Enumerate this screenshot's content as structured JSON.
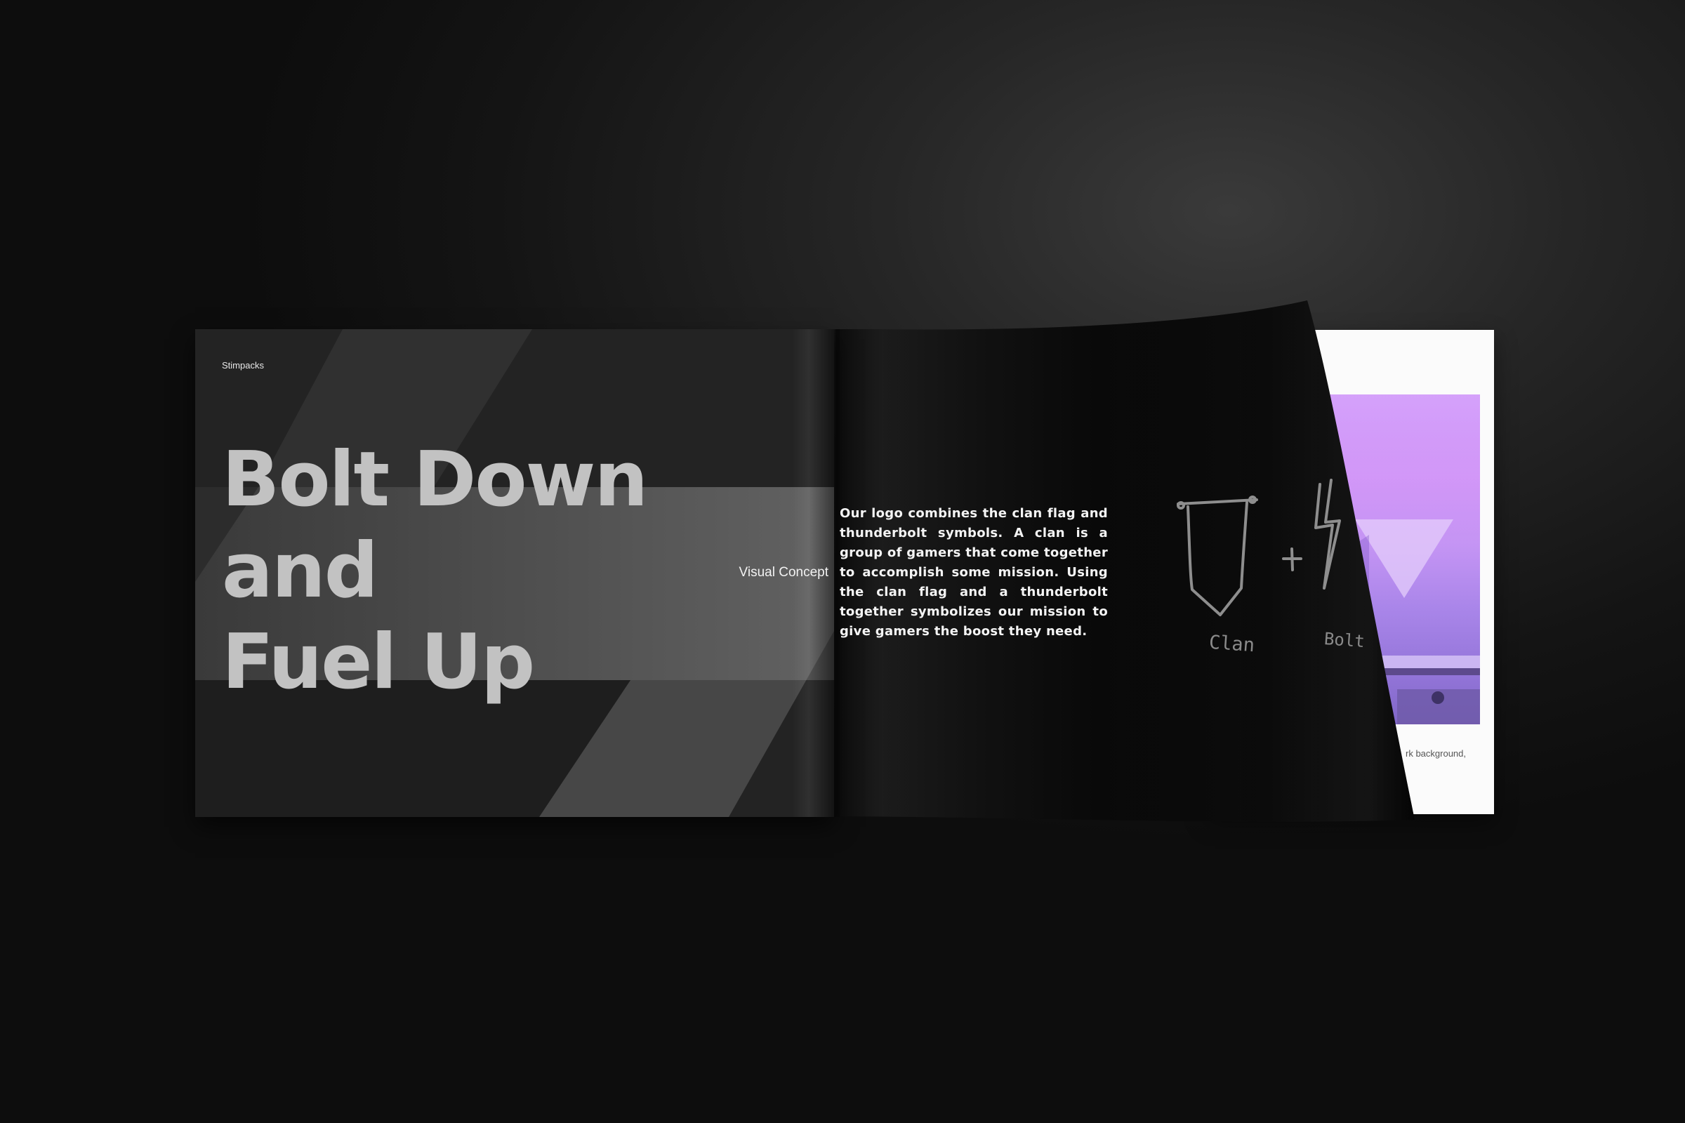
{
  "brochure": {
    "brand_label": "Stimpacks",
    "headline": "Bolt Down\nand\nFuel Up",
    "section_title": "Visual Concept",
    "body_copy": "Our logo combines the clan flag and thunderbolt symbols. A clan is a group of gamers that come together to accomplish some mission. Using the clan flag and a thunderbolt together symbolizes our mission to give gamers the boost they need.",
    "sketch": {
      "clan_label": "Clan",
      "plus_symbol": "+",
      "bolt_label": "Bolt",
      "flag_icon": "flag-sketch-icon",
      "bolt_icon": "thunderbolt-sketch-icon"
    },
    "back_page_caption": "rk background,"
  },
  "colors": {
    "background": "#141414",
    "page_dark": "#232323",
    "headline": "#c2c2c2",
    "photo_accent": "#b47ff0",
    "body_text": "#f4f4f4"
  }
}
